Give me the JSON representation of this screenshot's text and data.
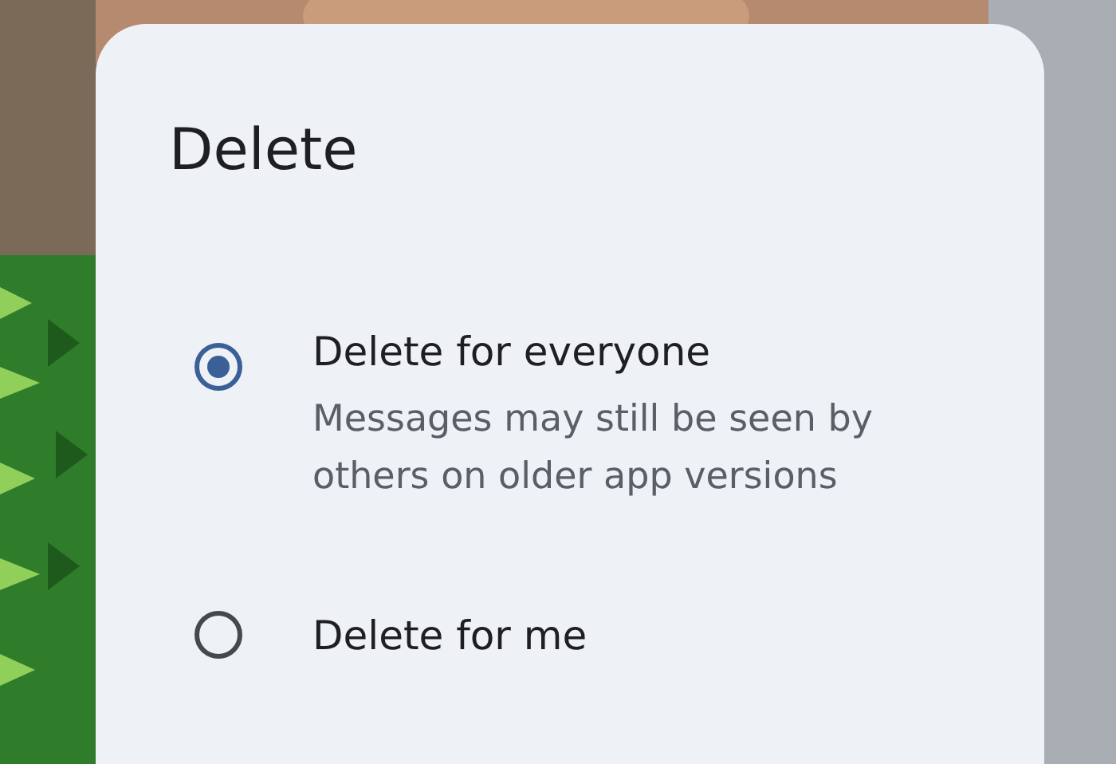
{
  "dialog": {
    "title": "Delete",
    "options": [
      {
        "label": "Delete for everyone",
        "description": "Messages may still be seen by others on older app versions",
        "selected": true
      },
      {
        "label": "Delete for me",
        "selected": false
      }
    ]
  }
}
